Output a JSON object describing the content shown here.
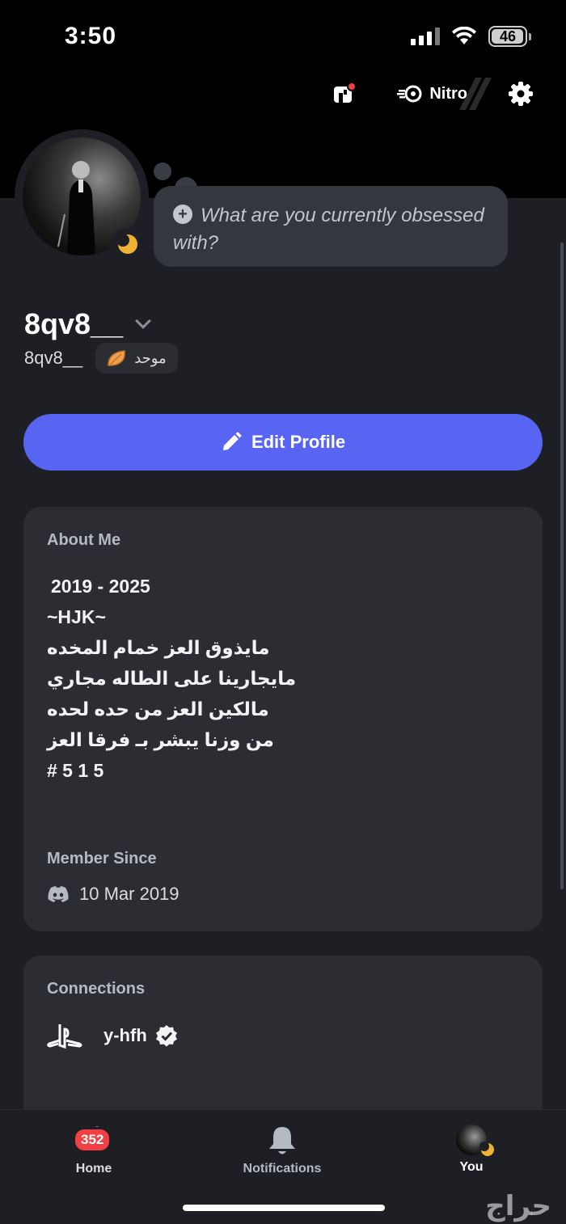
{
  "status_bar": {
    "time": "3:50",
    "battery": "46"
  },
  "top_actions": {
    "nitro_label": "Nitro"
  },
  "profile": {
    "status_prompt": "What are you currently obsessed with?",
    "display_name": "8qv8__",
    "username": "8qv8__",
    "tag_text": "موحد",
    "edit_label": "Edit Profile"
  },
  "about": {
    "label": "About Me",
    "bio_lines": [
      "2019 - 2025",
      "~HJK~",
      "مايذوق العز خمام المخده",
      "مايجارينا على الطاله مجاري",
      "مالكين العز من حده لحده",
      "من وزنا يبشر بـ فرقا العز",
      "# 5 1 5"
    ],
    "member_since_label": "Member Since",
    "member_since_date": "10 Mar 2019"
  },
  "connections": {
    "label": "Connections",
    "items": [
      {
        "service_icon": "playstation-icon",
        "name": "y-hfh",
        "verified": true
      }
    ]
  },
  "nav": {
    "home_label": "Home",
    "home_badge": "352",
    "notifications_label": "Notifications",
    "you_label": "You"
  },
  "watermark": "حراج",
  "colors": {
    "accent": "#5865f2",
    "badge": "#f23f43",
    "idle": "#f0b232",
    "background": "#1e1f24",
    "card": "#2b2d33"
  }
}
